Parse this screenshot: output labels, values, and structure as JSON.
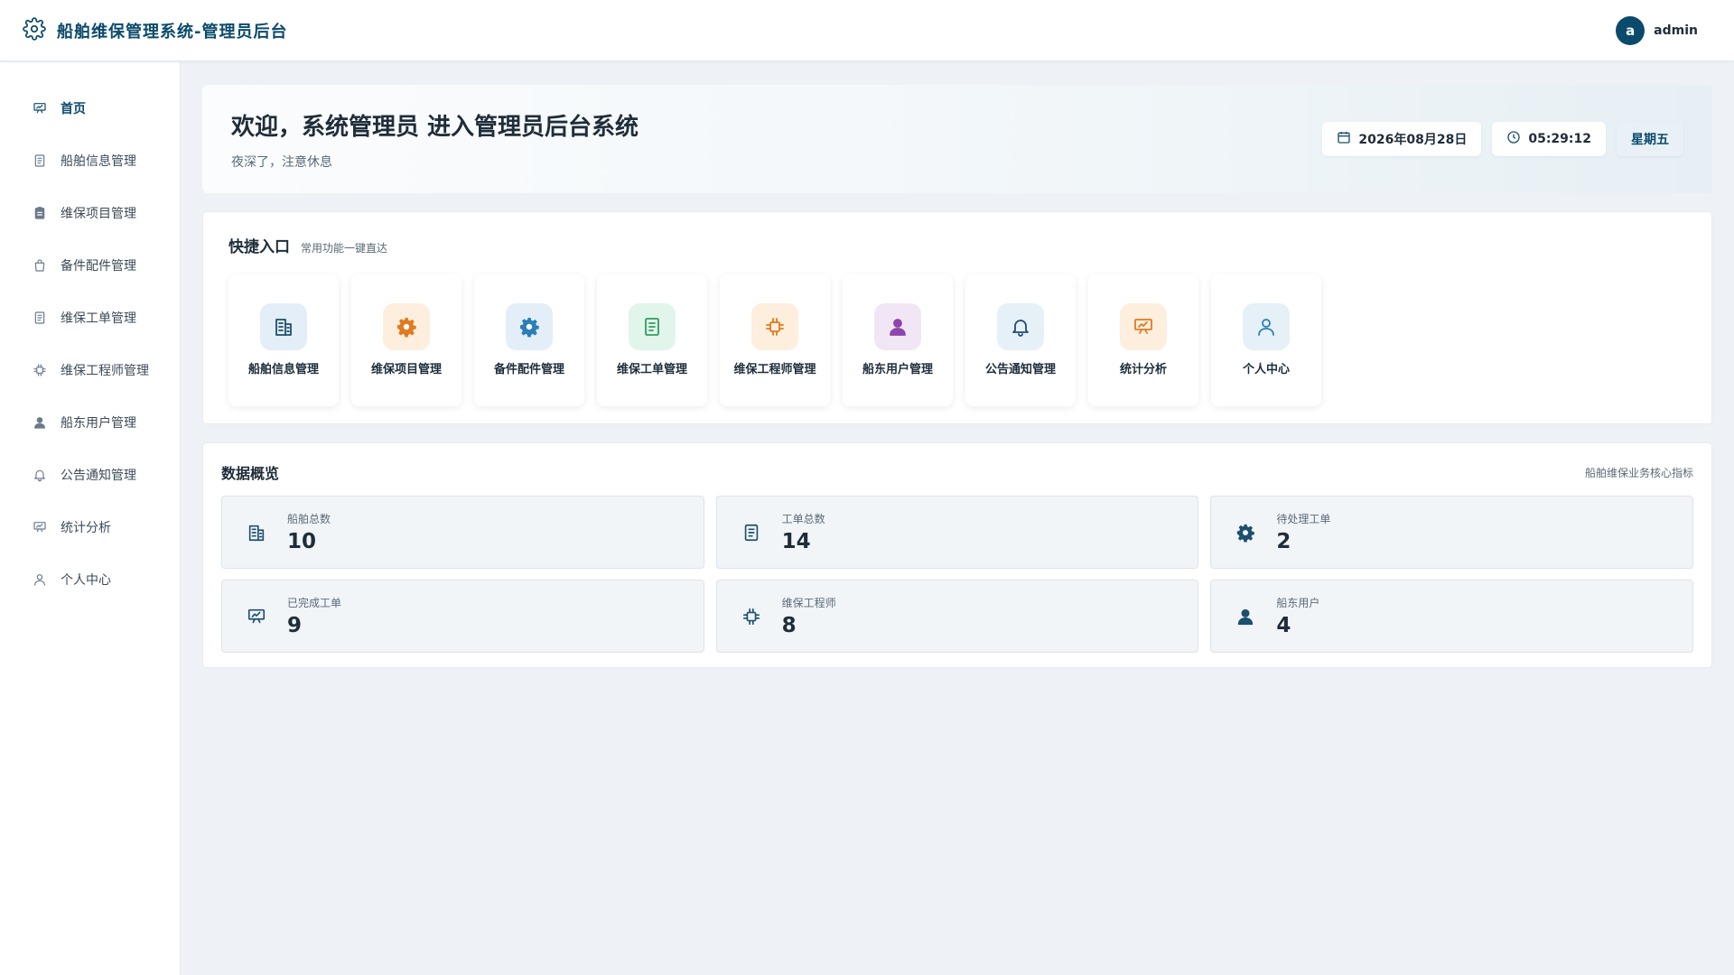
{
  "header": {
    "title": "船舶维保管理系统-管理员后台",
    "avatar_letter": "a",
    "username": "admin"
  },
  "sidebar": {
    "items": [
      {
        "label": "首页",
        "icon": "presentation-icon",
        "active": true
      },
      {
        "label": "船舶信息管理",
        "icon": "document-icon"
      },
      {
        "label": "维保项目管理",
        "icon": "clipboard-icon"
      },
      {
        "label": "备件配件管理",
        "icon": "bag-icon"
      },
      {
        "label": "维保工单管理",
        "icon": "document-icon"
      },
      {
        "label": "维保工程师管理",
        "icon": "chip-icon"
      },
      {
        "label": "船东用户管理",
        "icon": "user-icon"
      },
      {
        "label": "公告通知管理",
        "icon": "bell-icon"
      },
      {
        "label": "统计分析",
        "icon": "presentation-icon"
      },
      {
        "label": "个人中心",
        "icon": "user-outline-icon"
      }
    ]
  },
  "welcome": {
    "title": "欢迎，系统管理员 进入管理员后台系统",
    "subtitle": "夜深了，注意休息",
    "date": "2026年08月28日",
    "time": "05:29:12",
    "weekday": "星期五"
  },
  "quick": {
    "title": "快捷入口",
    "subtitle": "常用功能一键直达",
    "tiles": [
      {
        "label": "船舶信息管理",
        "icon": "building-icon",
        "bg": "#e3eef8",
        "fg": "#1d4f6e"
      },
      {
        "label": "维保项目管理",
        "icon": "gear-icon",
        "bg": "#fdeede",
        "fg": "#e07b1f"
      },
      {
        "label": "备件配件管理",
        "icon": "gear-icon",
        "bg": "#e3eef8",
        "fg": "#2a7fb8"
      },
      {
        "label": "维保工单管理",
        "icon": "document-icon",
        "bg": "#e2f5ea",
        "fg": "#2f9e5e"
      },
      {
        "label": "维保工程师管理",
        "icon": "chip-icon",
        "bg": "#fdeede",
        "fg": "#e07b1f"
      },
      {
        "label": "船东用户管理",
        "icon": "user-icon",
        "bg": "#f1e6f5",
        "fg": "#8e44ad"
      },
      {
        "label": "公告通知管理",
        "icon": "bell-icon",
        "bg": "#e6f0f7",
        "fg": "#1d4f6e"
      },
      {
        "label": "统计分析",
        "icon": "presentation-icon",
        "bg": "#fdeede",
        "fg": "#e07b1f"
      },
      {
        "label": "个人中心",
        "icon": "user-outline-icon",
        "bg": "#e6f0f7",
        "fg": "#2a7fb8"
      }
    ]
  },
  "overview": {
    "title": "数据概览",
    "subtitle": "船舶维保业务核心指标",
    "stats": [
      {
        "label": "船舶总数",
        "value": "10",
        "icon": "building-icon"
      },
      {
        "label": "工单总数",
        "value": "14",
        "icon": "document-icon"
      },
      {
        "label": "待处理工单",
        "value": "2",
        "icon": "gear-icon"
      },
      {
        "label": "已完成工单",
        "value": "9",
        "icon": "presentation-icon"
      },
      {
        "label": "维保工程师",
        "value": "8",
        "icon": "chip-icon"
      },
      {
        "label": "船东用户",
        "value": "4",
        "icon": "user-icon"
      }
    ]
  },
  "colors": {
    "brand": "#0b4a6b",
    "background": "#eef2f6"
  }
}
